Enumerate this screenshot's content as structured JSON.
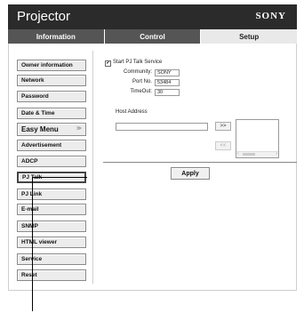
{
  "header": {
    "title": "Projector",
    "brand": "SONY"
  },
  "tabs": [
    {
      "label": "Information"
    },
    {
      "label": "Control"
    },
    {
      "label": "Setup"
    }
  ],
  "sidebar": {
    "items": [
      {
        "label": "Owner information"
      },
      {
        "label": "Network"
      },
      {
        "label": "Password"
      },
      {
        "label": "Date & Time"
      },
      {
        "label": "Easy Menu",
        "arrow": "≫"
      },
      {
        "label": "Advertisement"
      },
      {
        "label": "ADCP"
      },
      {
        "label": "PJ Talk"
      },
      {
        "label": "PJ Link"
      },
      {
        "label": "E-mail"
      },
      {
        "label": "SNMP"
      },
      {
        "label": "HTML viewer"
      },
      {
        "label": "Service"
      },
      {
        "label": "Reset"
      }
    ]
  },
  "pjtalk": {
    "start_label": "Start PJ Talk Service",
    "start_checked": "✔",
    "community_label": "Community:",
    "community_value": "SONY",
    "port_label": "Port No.",
    "port_value": "53484",
    "timeout_label": "TimeOut:",
    "timeout_value": "30",
    "host_label": "Host Address",
    "host_value": "",
    "add_button": ">>",
    "remove_button": "<<",
    "scroll_left": "‹",
    "scroll_right": "›",
    "apply_button": "Apply"
  }
}
